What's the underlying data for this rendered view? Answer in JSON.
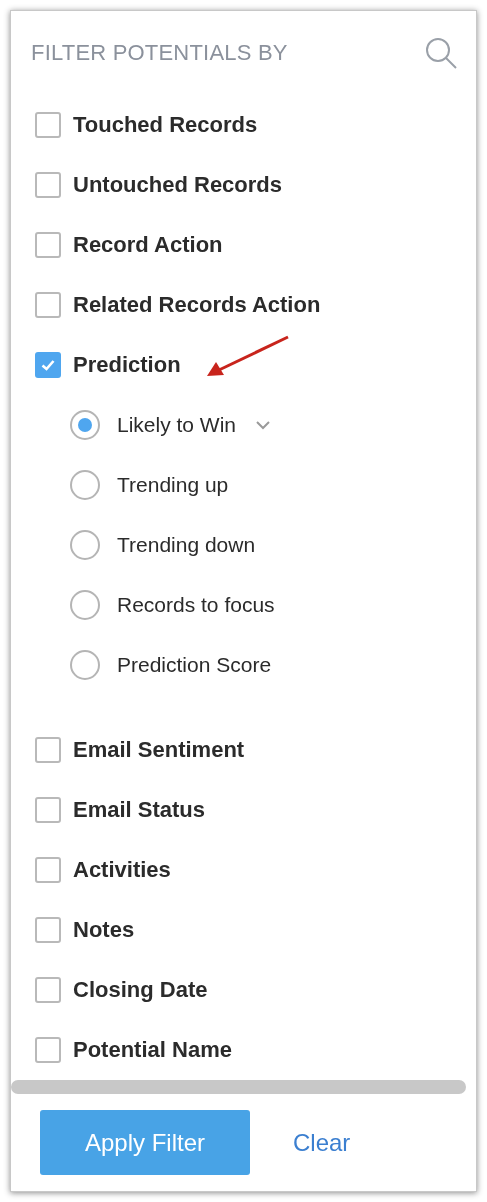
{
  "header": {
    "title": "FILTER POTENTIALS BY"
  },
  "filters": [
    {
      "label": "Touched Records",
      "checked": false
    },
    {
      "label": "Untouched Records",
      "checked": false
    },
    {
      "label": "Record Action",
      "checked": false
    },
    {
      "label": "Related Records Action",
      "checked": false
    },
    {
      "label": "Prediction",
      "checked": true,
      "options": [
        {
          "label": "Likely to Win",
          "selected": true,
          "dropdown": true
        },
        {
          "label": "Trending up",
          "selected": false,
          "dropdown": false
        },
        {
          "label": "Trending down",
          "selected": false,
          "dropdown": false
        },
        {
          "label": "Records to focus",
          "selected": false,
          "dropdown": false
        },
        {
          "label": "Prediction Score",
          "selected": false,
          "dropdown": false
        }
      ]
    },
    {
      "label": "Email Sentiment",
      "checked": false
    },
    {
      "label": "Email Status",
      "checked": false
    },
    {
      "label": "Activities",
      "checked": false
    },
    {
      "label": "Notes",
      "checked": false
    },
    {
      "label": "Closing Date",
      "checked": false
    },
    {
      "label": "Potential Name",
      "checked": false
    }
  ],
  "footer": {
    "apply": "Apply Filter",
    "clear": "Clear"
  }
}
